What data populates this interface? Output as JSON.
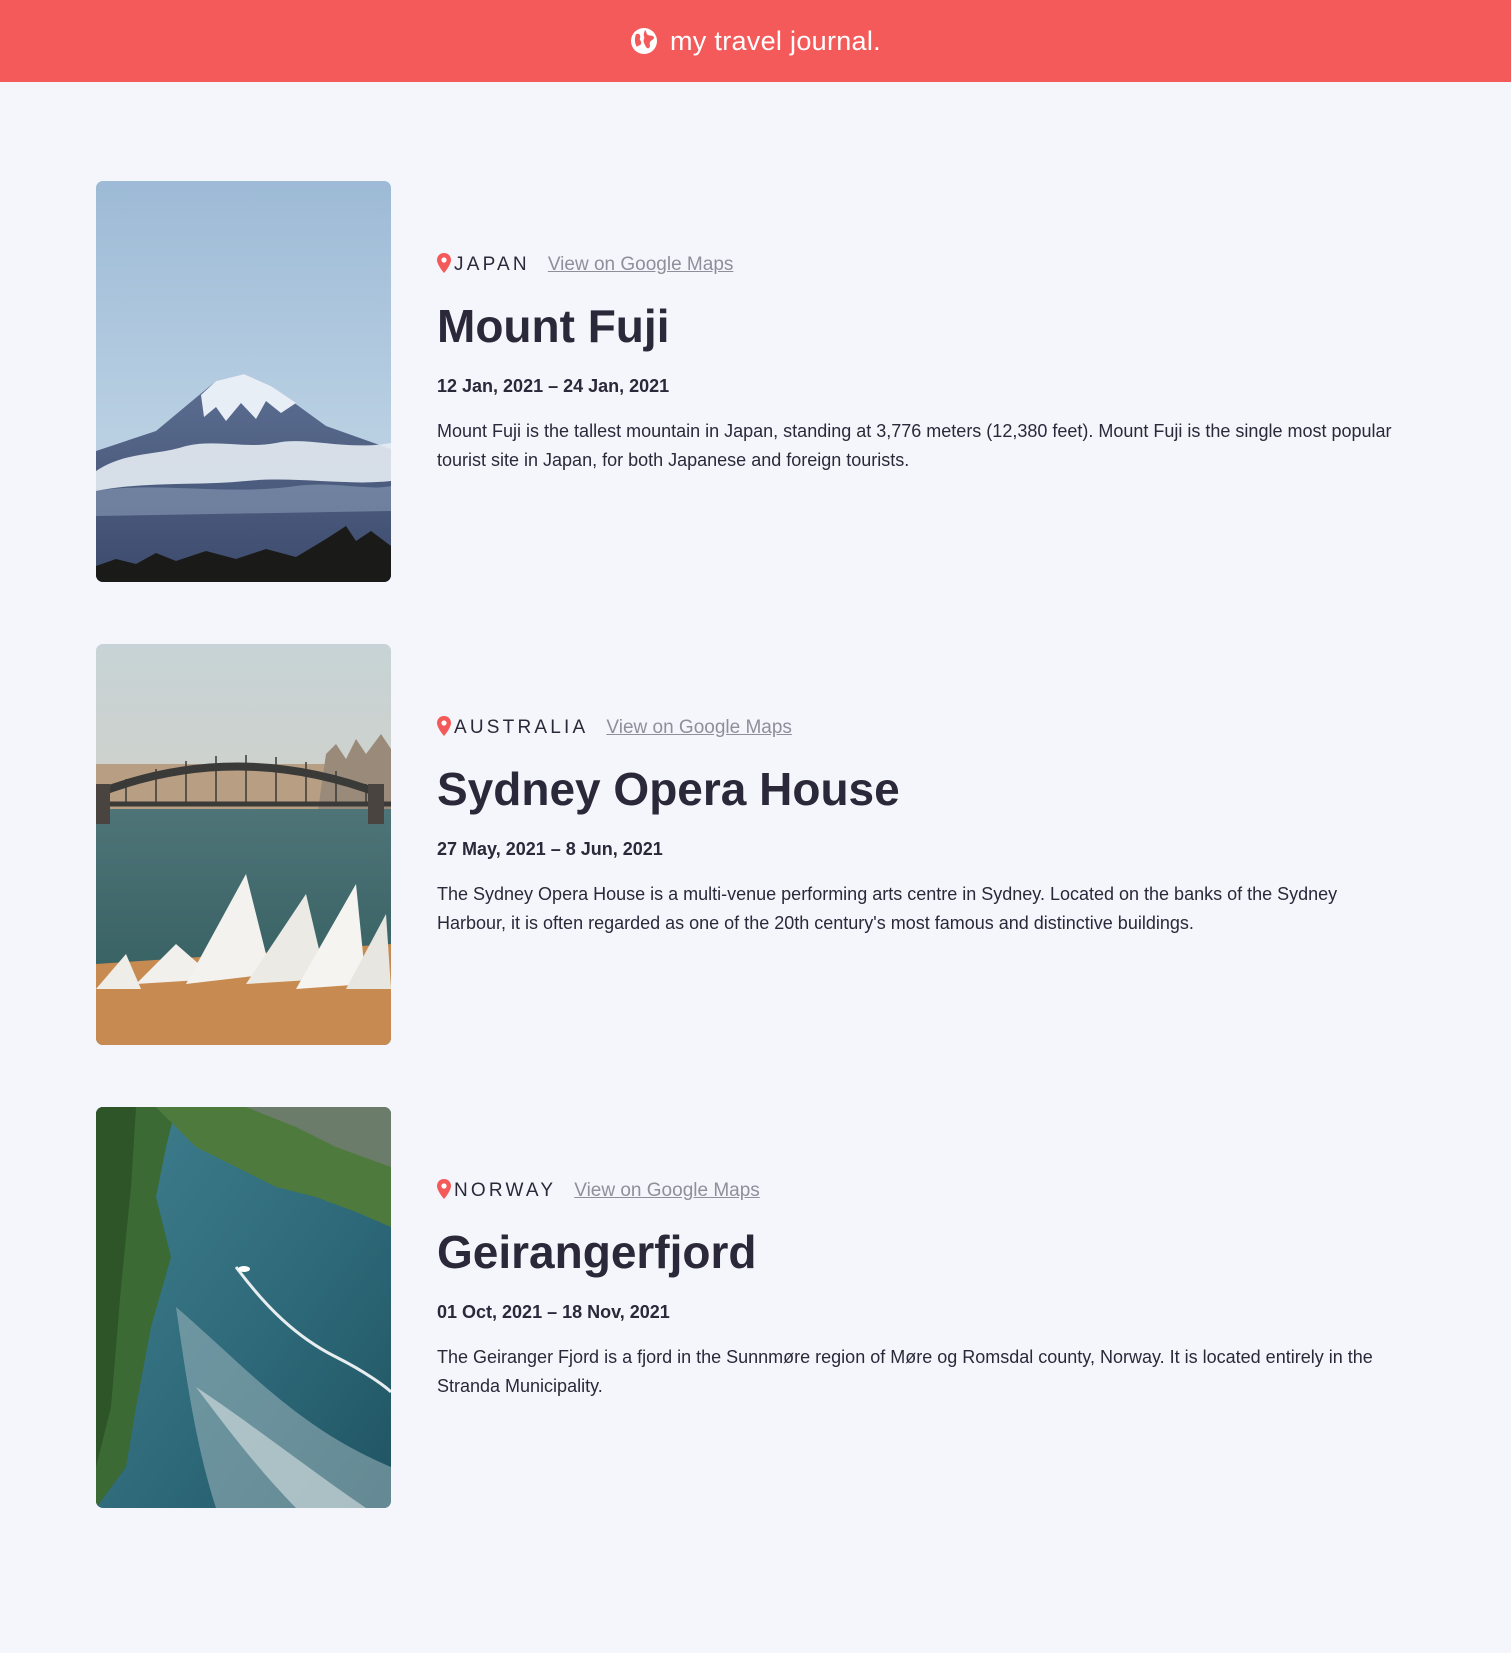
{
  "navbar": {
    "brand": "my travel journal.",
    "icon": "globe-icon",
    "background": "#f55a5a"
  },
  "entries": [
    {
      "image_alt": "mount-fuji-photo",
      "location": "JAPAN",
      "maps_link_label": "View on Google Maps",
      "title": "Mount Fuji",
      "dates": "12 Jan, 2021 – 24 Jan, 2021",
      "description": "Mount Fuji is the tallest mountain in Japan, standing at 3,776 meters (12,380 feet). Mount Fuji is the single most popular tourist site in Japan, for both Japanese and foreign tourists."
    },
    {
      "image_alt": "sydney-opera-house-photo",
      "location": "AUSTRALIA",
      "maps_link_label": "View on Google Maps",
      "title": "Sydney Opera House",
      "dates": "27 May, 2021 – 8 Jun, 2021",
      "description": "The Sydney Opera House is a multi-venue performing arts centre in Sydney. Located on the banks of the Sydney Harbour, it is often regarded as one of the 20th century's most famous and distinctive buildings."
    },
    {
      "image_alt": "geirangerfjord-photo",
      "location": "NORWAY",
      "maps_link_label": "View on Google Maps",
      "title": "Geirangerfjord",
      "dates": "01 Oct, 2021 – 18 Nov, 2021",
      "description": "The Geiranger Fjord is a fjord in the Sunnmøre region of Møre og Romsdal county, Norway. It is located entirely in the Stranda Municipality."
    }
  ],
  "colors": {
    "accent": "#f55a5a",
    "text": "#2b283a",
    "muted": "#918e9b",
    "background": "#f5f6fb"
  }
}
